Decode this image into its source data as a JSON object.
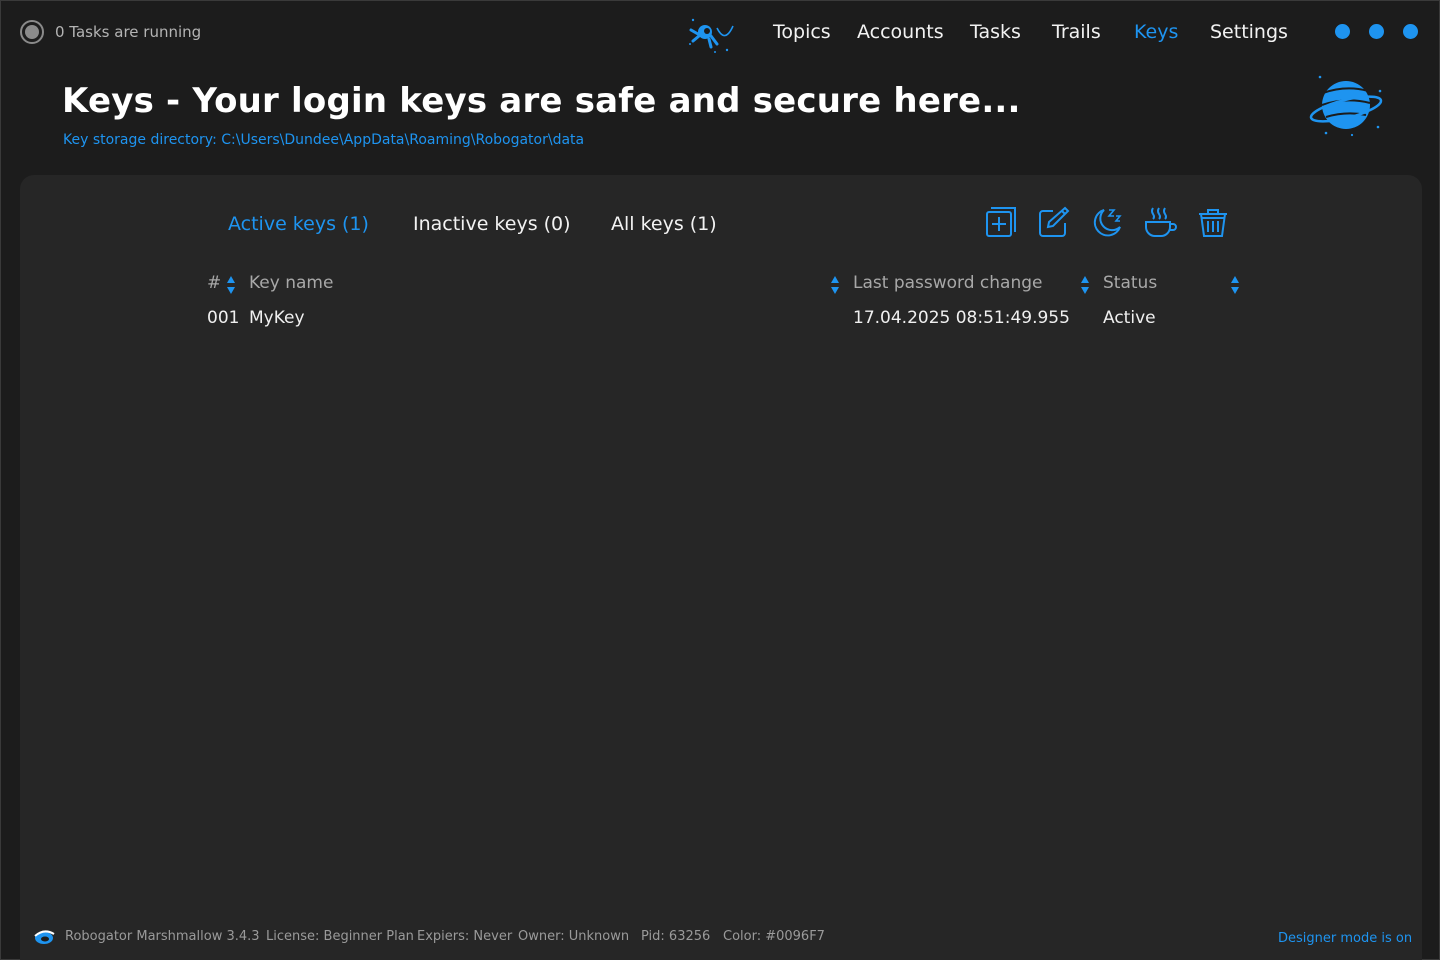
{
  "status": {
    "text": "0 Tasks are running"
  },
  "nav": {
    "items": [
      {
        "label": "Topics",
        "active": false
      },
      {
        "label": "Accounts",
        "active": false
      },
      {
        "label": "Tasks",
        "active": false
      },
      {
        "label": "Trails",
        "active": false
      },
      {
        "label": "Keys",
        "active": true
      },
      {
        "label": "Settings",
        "active": false
      }
    ]
  },
  "header": {
    "title": "Keys - Your login keys are safe and secure here...",
    "subtitle": "Key storage directory: C:\\Users\\Dundee\\AppData\\Roaming\\Robogator\\data"
  },
  "tabs": [
    {
      "label": "Active keys (1)",
      "active": true
    },
    {
      "label": "Inactive keys (0)",
      "active": false
    },
    {
      "label": "All keys (1)",
      "active": false
    }
  ],
  "toolbar": {
    "icons": [
      "add-icon",
      "edit-icon",
      "sleep-icon",
      "coffee-icon",
      "trash-icon"
    ]
  },
  "table": {
    "columns": [
      "#",
      "Key name",
      "Last password change",
      "Status"
    ],
    "rows": [
      {
        "num": "001",
        "name": "MyKey",
        "last_change": "17.04.2025 08:51:49.955",
        "status": "Active"
      }
    ]
  },
  "footer": {
    "app": "Robogator Marshmallow 3.4.3",
    "license": "License: Beginner Plan",
    "expires": "Expiers: Never",
    "owner": "Owner: Unknown",
    "pid": "Pid: 63256",
    "color": "Color: #0096F7",
    "designer": "Designer mode is on"
  },
  "colors": {
    "accent": "#1E94F0",
    "background": "#1C1C1C",
    "panel": "#262626"
  }
}
